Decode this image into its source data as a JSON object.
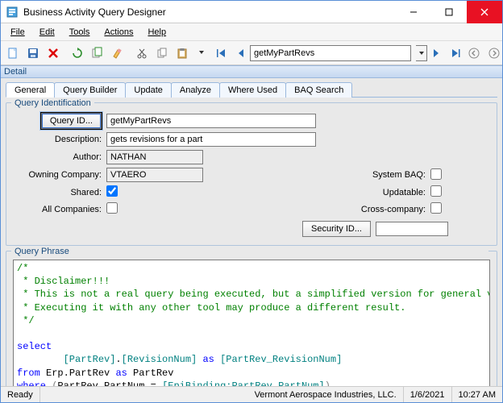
{
  "window": {
    "title": "Business Activity Query Designer"
  },
  "menu": {
    "file": "File",
    "edit": "Edit",
    "tools": "Tools",
    "actions": "Actions",
    "help": "Help"
  },
  "toolbar": {
    "query_value": "getMyPartRevs"
  },
  "panel": {
    "detail_title": "Detail",
    "tabs": {
      "general": "General",
      "query_builder": "Query Builder",
      "update": "Update",
      "analyze": "Analyze",
      "where_used": "Where Used",
      "baq_search": "BAQ Search"
    }
  },
  "groups": {
    "query_identification": "Query Identification",
    "query_phrase": "Query Phrase"
  },
  "labels": {
    "query_id_btn": "Query ID...",
    "description": "Description:",
    "author": "Author:",
    "owning_company": "Owning Company:",
    "shared": "Shared:",
    "all_companies": "All Companies:",
    "system_baq": "System BAQ:",
    "updatable": "Updatable:",
    "cross_company": "Cross-company:",
    "security_id_btn": "Security ID..."
  },
  "values": {
    "query_id": "getMyPartRevs",
    "description": "gets revisions for a part",
    "author": "NATHAN",
    "owning_company": "VTAERO",
    "shared": true,
    "all_companies": false,
    "system_baq": false,
    "updatable": false,
    "cross_company": false,
    "security_id": ""
  },
  "sql": {
    "c1": "/*",
    "c2": " * Disclaimer!!!",
    "c3": " * This is not a real query being executed, but a simplified version for general vision.",
    "c4": " * Executing it with any other tool may produce a different result.",
    "c5": " */",
    "kw_select": "select",
    "col_token1": "[PartRev]",
    "dot1": ".",
    "col_token2": "[RevisionNum]",
    "kw_as1": "as",
    "alias1": "[PartRev_RevisionNum]",
    "kw_from": "from",
    "tbl": "Erp.PartRev",
    "kw_as2": "as",
    "tbl_alias": "PartRev",
    "kw_where": "where",
    "paren_open": "(",
    "where_lhs": "PartRev.PartNum",
    "eq": " = ",
    "where_rhs": "[EpiBinding:PartRev_PartNum]",
    "paren_close": ")"
  },
  "status": {
    "ready": "Ready",
    "company": "Vermont Aerospace Industries, LLC.",
    "date": "1/6/2021",
    "time": "10:27 AM"
  }
}
